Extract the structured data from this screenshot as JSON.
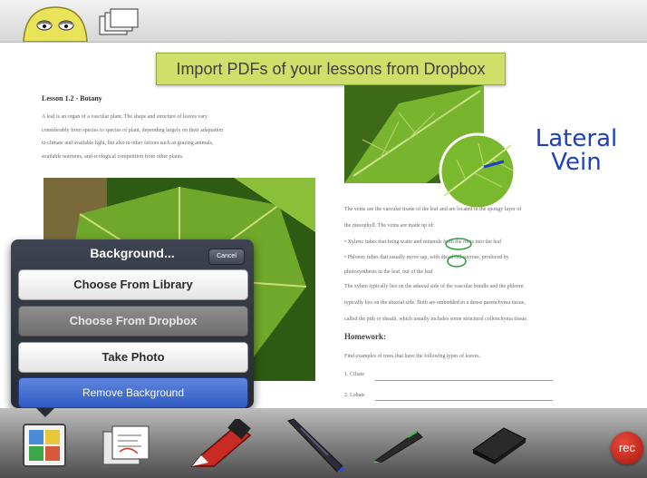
{
  "banner": {
    "text": "Import PDFs of your lessons from Dropbox"
  },
  "lesson": {
    "title": "Lesson 1.2 - Botany",
    "paragraph_lines": [
      "A leaf is an organ of a vascular plant. The shape and structure of leaves vary",
      "considerably from species to species of plant, depending largely on their adaptation",
      "to climate and available light, but also to other factors such as grazing animals,",
      "available nutrients, and ecological competition from other plants."
    ]
  },
  "annotation": {
    "line1": "Lateral",
    "line2": "Vein"
  },
  "right_text": {
    "lines": [
      "The veins are the vascular tissue of the leaf and are located in the spongy layer of",
      "the mesophyll. The veins are made up of:",
      "•        Xylem: tubes that bring water and minerals from the roots into the leaf",
      "•        Phloem: tubes that usually move sap, with dissolved sucrose, produced by",
      "photosynthesis in the leaf, out of the leaf",
      "The xylem typically lies on the adaxial side of the vascular bundle and the phloem",
      "typically lies on the abaxial side. Both are embedded in a dense parenchyma tissue,",
      "called the pith or sheath, which usually includes some structural collenchyma tissue."
    ],
    "homework_title": "Homework:",
    "homework_prompt": "Find examples of trees that have the following types of leaves.",
    "item1": "1. Ciliate",
    "item2": "2. Lobate"
  },
  "popover": {
    "title": "Background...",
    "cancel": "Cancel",
    "choose_library": "Choose From Library",
    "choose_dropbox": "Choose From Dropbox",
    "take_photo": "Take Photo",
    "remove_background": "Remove Background"
  },
  "toolbar": {
    "rec_label": "rec",
    "tools": [
      "background-icon",
      "pages-icon",
      "red-marker-icon",
      "blue-pen-icon",
      "green-pen-icon",
      "eraser-icon"
    ]
  },
  "colors": {
    "banner": "#cfe06a",
    "annotation": "#1e3fbf",
    "remove_button": "#2f5bc2",
    "rec": "#c0241a"
  }
}
